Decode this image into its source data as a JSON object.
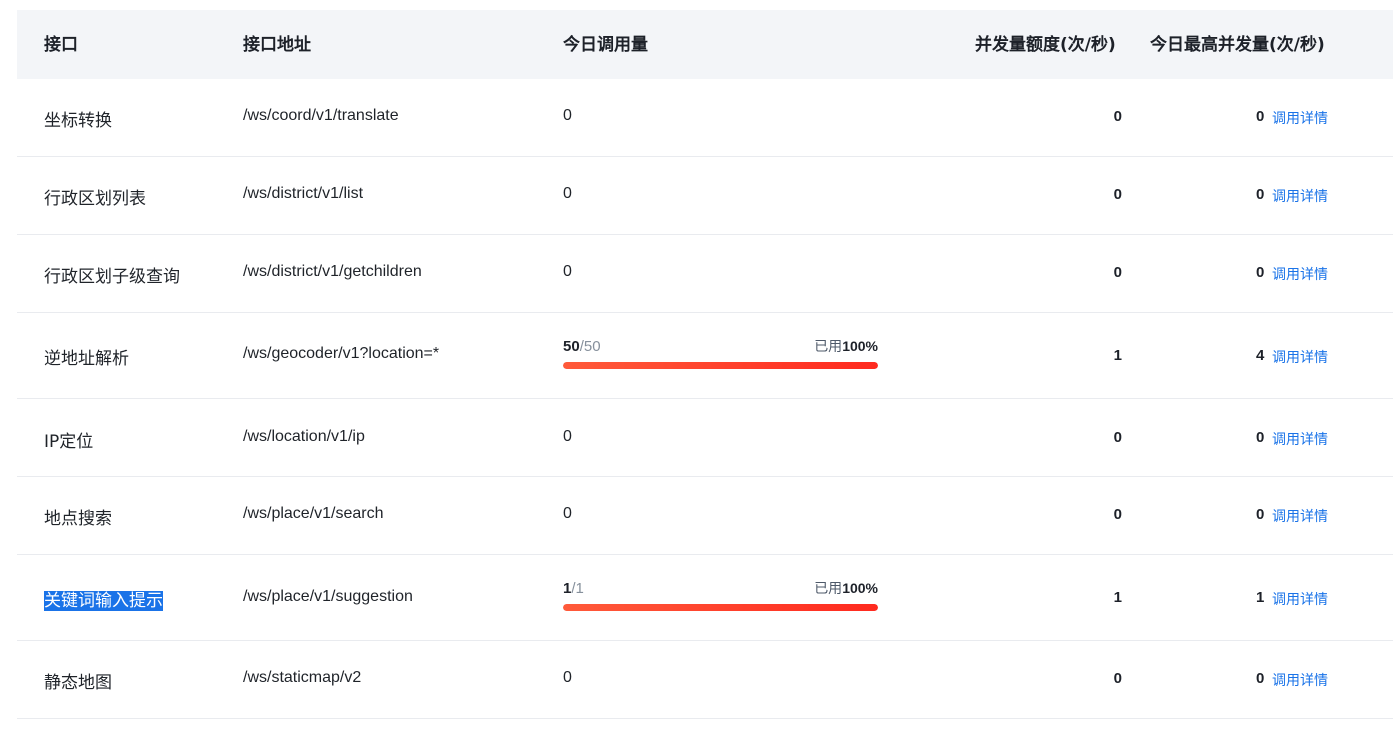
{
  "headers": {
    "api": "接口",
    "address": "接口地址",
    "today_calls": "今日调用量",
    "concurrency_quota": "并发量额度(次/秒)",
    "peak_concurrency": "今日最高并发量(次/秒)"
  },
  "rows": [
    {
      "name": "坐标转换",
      "address": "/ws/coord/v1/translate",
      "calls": "0",
      "quota": "0",
      "peak": "0",
      "detail": "调用详情"
    },
    {
      "name": "行政区划列表",
      "address": "/ws/district/v1/list",
      "calls": "0",
      "quota": "0",
      "peak": "0",
      "detail": "调用详情"
    },
    {
      "name": "行政区划子级查询",
      "address": "/ws/district/v1/getchildren",
      "calls": "0",
      "quota": "0",
      "peak": "0",
      "detail": "调用详情"
    },
    {
      "name": "逆地址解析",
      "address": "/ws/geocoder/v1?location=*",
      "usage": {
        "used": "50",
        "total": "/50",
        "pct_prefix": "已用",
        "pct": "100%",
        "fill": 1.0
      },
      "quota": "1",
      "peak": "4",
      "detail": "调用详情"
    },
    {
      "name": "IP定位",
      "address": "/ws/location/v1/ip",
      "calls": "0",
      "quota": "0",
      "peak": "0",
      "detail": "调用详情"
    },
    {
      "name": "地点搜索",
      "address": "/ws/place/v1/search",
      "calls": "0",
      "quota": "0",
      "peak": "0",
      "detail": "调用详情"
    },
    {
      "name": "关键词输入提示",
      "address": "/ws/place/v1/suggestion",
      "usage": {
        "used": "1",
        "total": "/1",
        "pct_prefix": "已用",
        "pct": "100%",
        "fill": 1.0
      },
      "quota": "1",
      "peak": "1",
      "detail": "调用详情",
      "selected": true
    },
    {
      "name": "静态地图",
      "address": "/ws/staticmap/v2",
      "calls": "0",
      "quota": "0",
      "peak": "0",
      "detail": "调用详情"
    }
  ],
  "colors": {
    "link": "#1a73e8",
    "progress": "#ff3b2a",
    "header_bg": "#f3f5f8",
    "selection": "#1a73e8"
  }
}
